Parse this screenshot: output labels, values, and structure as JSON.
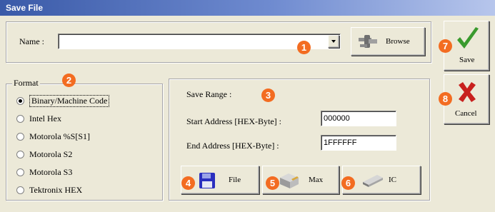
{
  "window": {
    "title": "Save File"
  },
  "name_row": {
    "label": "Name :",
    "value": "",
    "browse_label": "Browse"
  },
  "format": {
    "legend": "Format",
    "options": [
      {
        "label": "Binary/Machine Code",
        "selected": true
      },
      {
        "label": "Intel Hex",
        "selected": false
      },
      {
        "label": "Motorola %S[S1]",
        "selected": false
      },
      {
        "label": "Motorola S2",
        "selected": false
      },
      {
        "label": "Motorola S3",
        "selected": false
      },
      {
        "label": "Tektronix HEX",
        "selected": false
      }
    ]
  },
  "save_range": {
    "label": "Save Range :",
    "start_label": "Start Address [HEX-Byte] :",
    "start_value": "000000",
    "end_label": "End Address [HEX-Byte] :",
    "end_value": "1FFFFFF"
  },
  "source_buttons": {
    "file": "File",
    "max": "Max",
    "ic": "IC"
  },
  "actions": {
    "save": "Save",
    "cancel": "Cancel"
  },
  "badges": [
    "1",
    "2",
    "3",
    "4",
    "5",
    "6",
    "7",
    "8"
  ],
  "colors": {
    "badge": "#f36c21",
    "save_check": "#3a9a2e",
    "cancel_x": "#c8201e"
  }
}
